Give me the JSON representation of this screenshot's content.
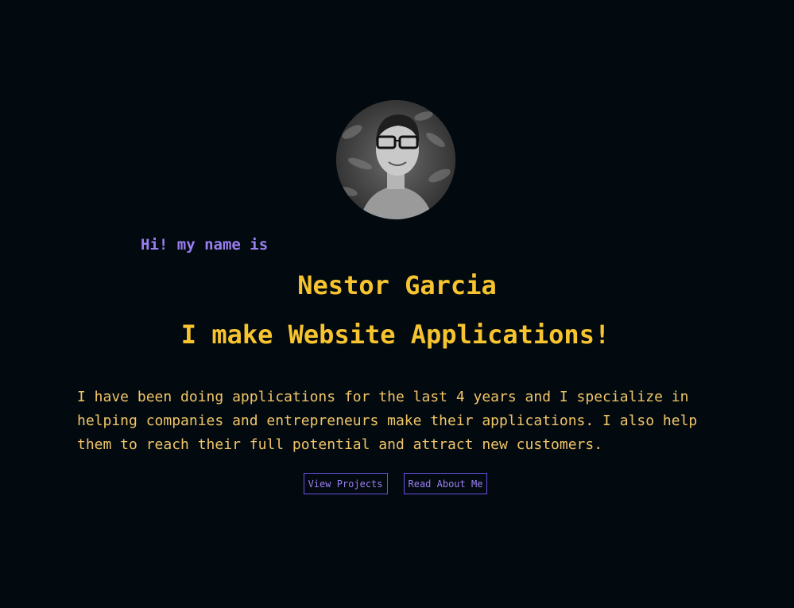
{
  "hero": {
    "greeting": "Hi! my name is",
    "name": "Nestor Garcia",
    "tagline": "I make Website Applications!",
    "bio": "I have been doing applications for the last 4 years and I specialize in helping companies and entrepreneurs make their applications. I also help them to reach their full potential and attract new customers."
  },
  "actions": {
    "view_projects": "View Projects",
    "read_about_me": "Read About Me"
  },
  "colors": {
    "background": "#020a10",
    "accent_yellow": "#f7c42f",
    "accent_purple": "#9b7ff0",
    "body_text": "#f1c467"
  }
}
